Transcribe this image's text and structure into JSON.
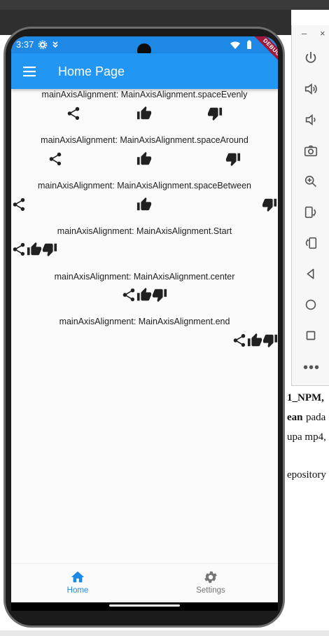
{
  "desktop": {
    "doc_fragments": [
      "1_NPM,",
      "ean",
      "pada",
      "upa mp4,",
      "epository"
    ]
  },
  "emulator_toolbar": {
    "minimize": "–",
    "close": "×",
    "more": "•••",
    "buttons": [
      "power-icon",
      "volume-up-icon",
      "volume-down-icon",
      "camera-icon",
      "zoom-icon",
      "rotate-left-icon",
      "rotate-right-icon",
      "back-icon",
      "home-circle-icon",
      "overview-icon"
    ]
  },
  "status_bar": {
    "time": "3:37",
    "icons": [
      "settings-icon",
      "app-notification-icon",
      "wifi-icon",
      "battery-icon"
    ]
  },
  "app_bar": {
    "title": "Home Page",
    "debug_banner": "DEBUG"
  },
  "rows": [
    {
      "label": "mainAxisAlignment: MainAxisAlignment.spaceEvenly",
      "icons": [
        "share-icon",
        "thumb-up-icon",
        "thumb-down-icon"
      ]
    },
    {
      "label": "mainAxisAlignment: MainAxisAlignment.spaceAround",
      "icons": [
        "share-icon",
        "thumb-up-icon",
        "thumb-down-icon"
      ]
    },
    {
      "label": "mainAxisAlignment: MainAxisAlignment.spaceBetween",
      "icons": [
        "share-icon",
        "thumb-up-icon",
        "thumb-down-icon"
      ]
    },
    {
      "label": "mainAxisAlignment: MainAxisAlignment.Start",
      "icons": [
        "share-icon",
        "thumb-up-icon",
        "thumb-down-icon"
      ]
    },
    {
      "label": "mainAxisAlignment: MainAxisAlignment.center",
      "icons": [
        "share-icon",
        "thumb-up-icon",
        "thumb-down-icon"
      ]
    },
    {
      "label": "mainAxisAlignment: MainAxisAlignment.end",
      "icons": [
        "share-icon",
        "thumb-up-icon",
        "thumb-down-icon"
      ]
    }
  ],
  "bottom_nav": {
    "items": [
      {
        "label": "Home",
        "icon": "home-icon",
        "active": true
      },
      {
        "label": "Settings",
        "icon": "settings-icon",
        "active": false
      }
    ]
  },
  "colors": {
    "primary": "#2196f3",
    "status_bar": "#1e88e5",
    "active_nav": "#1e88e5",
    "inactive_nav": "#757575",
    "debug_banner": "#a0193c",
    "icon": "#212121"
  }
}
